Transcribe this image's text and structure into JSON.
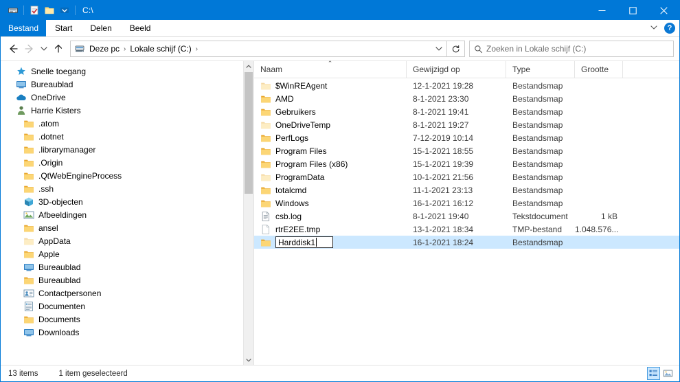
{
  "window": {
    "title": "C:\\",
    "quick_access": [
      {
        "name": "explorer-drive-icon",
        "label": "Eigenschappen"
      },
      {
        "name": "properties-icon",
        "label": "Eigenschappen"
      },
      {
        "name": "new-folder-icon",
        "label": "Nieuwe map"
      },
      {
        "name": "customize-dropdown-icon",
        "label": "Werkbalk Snelle toegang aanpassen"
      }
    ],
    "controls": {
      "minimize": "–",
      "maximize": "□",
      "close": "✕"
    }
  },
  "ribbon": {
    "tabs": [
      {
        "label": "Bestand",
        "active": true
      },
      {
        "label": "Start",
        "active": false
      },
      {
        "label": "Delen",
        "active": false
      },
      {
        "label": "Beeld",
        "active": false
      }
    ],
    "expand_label": "∨",
    "help_label": "?"
  },
  "addressbar": {
    "back": "←",
    "forward": "→",
    "recent": "∨",
    "up": "↑",
    "crumbs": [
      "Deze pc",
      "Lokale schijf (C:)"
    ],
    "separator": "›",
    "trailing_separator": "›",
    "dropdown": "∨",
    "refresh": "↻",
    "search_placeholder": "Zoeken in Lokale schijf (C:)",
    "search_value": ""
  },
  "sidebar": {
    "items": [
      {
        "label": "Snelle toegang",
        "icon": "star-icon",
        "indent": 0
      },
      {
        "label": "Bureaublad",
        "icon": "monitor-icon",
        "indent": 0
      },
      {
        "label": "OneDrive",
        "icon": "cloud-icon",
        "indent": 1
      },
      {
        "label": "Harrie Kisters",
        "icon": "user-icon",
        "indent": 1
      },
      {
        "label": ".atom",
        "icon": "folder-icon",
        "indent": 2
      },
      {
        "label": ".dotnet",
        "icon": "folder-icon",
        "indent": 2
      },
      {
        "label": ".librarymanager",
        "icon": "folder-icon",
        "indent": 2
      },
      {
        "label": ".Origin",
        "icon": "folder-icon",
        "indent": 2
      },
      {
        "label": ".QtWebEngineProcess",
        "icon": "folder-icon",
        "indent": 2
      },
      {
        "label": ".ssh",
        "icon": "folder-icon",
        "indent": 2
      },
      {
        "label": "3D-objecten",
        "icon": "3d-objects-icon",
        "indent": 2
      },
      {
        "label": "Afbeeldingen",
        "icon": "pictures-icon",
        "indent": 2
      },
      {
        "label": "ansel",
        "icon": "folder-icon",
        "indent": 2
      },
      {
        "label": "AppData",
        "icon": "folder-hidden-icon",
        "indent": 2
      },
      {
        "label": "Apple",
        "icon": "folder-icon",
        "indent": 2
      },
      {
        "label": "Bureaublad",
        "icon": "monitor-icon",
        "indent": 2
      },
      {
        "label": "Bureaublad",
        "icon": "folder-icon",
        "indent": 2
      },
      {
        "label": "Contactpersonen",
        "icon": "contacts-icon",
        "indent": 2
      },
      {
        "label": "Documenten",
        "icon": "documents-icon",
        "indent": 2
      },
      {
        "label": "Documents",
        "icon": "folder-icon",
        "indent": 2
      },
      {
        "label": "Downloads",
        "icon": "monitor-icon",
        "indent": 2
      }
    ]
  },
  "filelist": {
    "columns": [
      {
        "label": "Naam",
        "sorted": "asc"
      },
      {
        "label": "Gewijzigd op",
        "sorted": ""
      },
      {
        "label": "Type",
        "sorted": ""
      },
      {
        "label": "Grootte",
        "sorted": ""
      }
    ],
    "sort_caret": "⌃",
    "rows": [
      {
        "name": "$WinREAgent",
        "modified": "12-1-2021 19:28",
        "type": "Bestandsmap",
        "size": "",
        "icon": "folder-hidden-icon",
        "selected": false,
        "editing": false
      },
      {
        "name": "AMD",
        "modified": "8-1-2021 23:30",
        "type": "Bestandsmap",
        "size": "",
        "icon": "folder-icon",
        "selected": false,
        "editing": false
      },
      {
        "name": "Gebruikers",
        "modified": "8-1-2021 19:41",
        "type": "Bestandsmap",
        "size": "",
        "icon": "folder-icon",
        "selected": false,
        "editing": false
      },
      {
        "name": "OneDriveTemp",
        "modified": "8-1-2021 19:27",
        "type": "Bestandsmap",
        "size": "",
        "icon": "folder-hidden-icon",
        "selected": false,
        "editing": false
      },
      {
        "name": "PerfLogs",
        "modified": "7-12-2019 10:14",
        "type": "Bestandsmap",
        "size": "",
        "icon": "folder-icon",
        "selected": false,
        "editing": false
      },
      {
        "name": "Program Files",
        "modified": "15-1-2021 18:55",
        "type": "Bestandsmap",
        "size": "",
        "icon": "folder-icon",
        "selected": false,
        "editing": false
      },
      {
        "name": "Program Files (x86)",
        "modified": "15-1-2021 19:39",
        "type": "Bestandsmap",
        "size": "",
        "icon": "folder-icon",
        "selected": false,
        "editing": false
      },
      {
        "name": "ProgramData",
        "modified": "10-1-2021 21:56",
        "type": "Bestandsmap",
        "size": "",
        "icon": "folder-hidden-icon",
        "selected": false,
        "editing": false
      },
      {
        "name": "totalcmd",
        "modified": "11-1-2021 23:13",
        "type": "Bestandsmap",
        "size": "",
        "icon": "folder-icon",
        "selected": false,
        "editing": false
      },
      {
        "name": "Windows",
        "modified": "16-1-2021 16:12",
        "type": "Bestandsmap",
        "size": "",
        "icon": "folder-icon",
        "selected": false,
        "editing": false
      },
      {
        "name": "csb.log",
        "modified": "8-1-2021 19:40",
        "type": "Tekstdocument",
        "size": "1 kB",
        "icon": "text-file-icon",
        "selected": false,
        "editing": false
      },
      {
        "name": "rtrE2EE.tmp",
        "modified": "13-1-2021 18:34",
        "type": "TMP-bestand",
        "size": "1.048.576...",
        "icon": "blank-file-icon",
        "selected": false,
        "editing": false
      },
      {
        "name": "Harddisk1",
        "modified": "16-1-2021 18:24",
        "type": "Bestandsmap",
        "size": "",
        "icon": "folder-icon",
        "selected": true,
        "editing": true
      }
    ]
  },
  "statusbar": {
    "item_count": "13 items",
    "selection": "1 item geselecteerd",
    "views": [
      {
        "name": "details-view-button",
        "active": true
      },
      {
        "name": "large-icons-view-button",
        "active": false
      }
    ]
  }
}
